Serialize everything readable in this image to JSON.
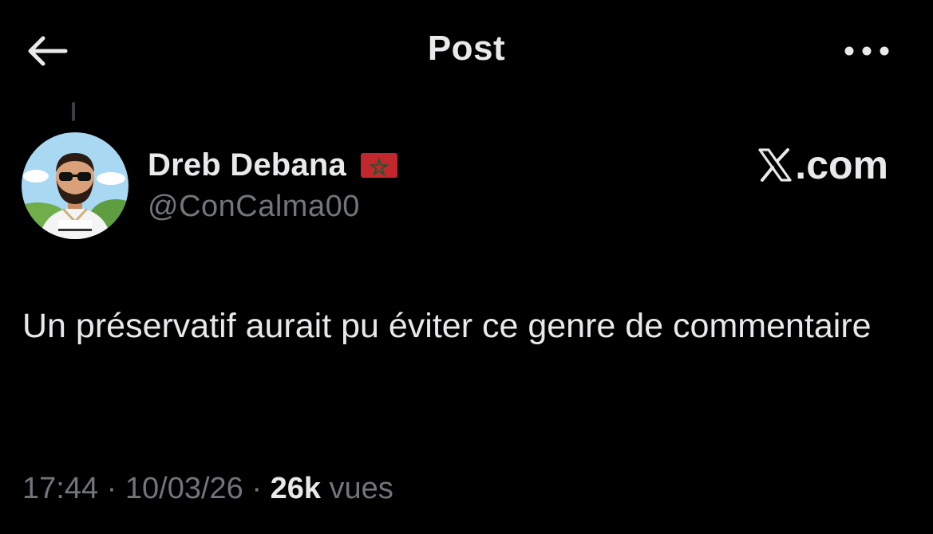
{
  "header": {
    "title": "Post",
    "back_icon": "arrow-left-icon",
    "more_icon": "more-horizontal-icon"
  },
  "author": {
    "display_name": "Dreb Debana",
    "handle": "@ConCalma00",
    "flag": "morocco-flag-icon",
    "avatar": "avatar-cartoon-man-sunglasses-shirt"
  },
  "watermark": {
    "text": ".com",
    "logo": "x-logo-icon"
  },
  "tweet": {
    "text": "Un préservatif aurait pu éviter ce genre de commentaire"
  },
  "meta": {
    "time": "17:44",
    "separator": " · ",
    "date": "10/03/26",
    "views_count": "26k",
    "views_label": "vues"
  },
  "colors": {
    "background": "#000000",
    "primary_text": "#e7e9ea",
    "secondary_text": "#71767b",
    "flag_red": "#c1272d",
    "flag_green": "#006233"
  }
}
